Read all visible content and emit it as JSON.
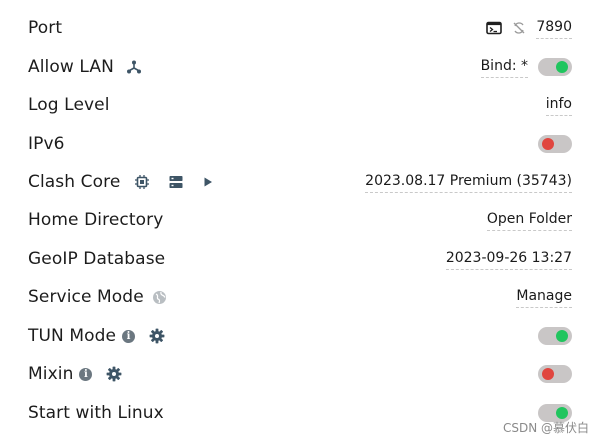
{
  "settings": {
    "port": {
      "label": "Port",
      "value": "7890",
      "icons": [
        "terminal-icon",
        "proxy-refresh-icon"
      ]
    },
    "allow_lan": {
      "label": "Allow LAN",
      "bind": "Bind: *",
      "toggle": "on",
      "icon": "network-icon"
    },
    "log_level": {
      "label": "Log Level",
      "value": "info"
    },
    "ipv6": {
      "label": "IPv6",
      "toggle": "off"
    },
    "clash_core": {
      "label": "Clash Core",
      "value": "2023.08.17 Premium (35743)",
      "icons": [
        "chip-icon",
        "server-icon",
        "play-icon"
      ]
    },
    "home_directory": {
      "label": "Home Directory",
      "value": "Open Folder"
    },
    "geoip": {
      "label": "GeoIP Database",
      "value": "2023-09-26 13:27"
    },
    "service_mode": {
      "label": "Service Mode",
      "value": "Manage",
      "icon": "globe-icon"
    },
    "tun_mode": {
      "label": "TUN Mode",
      "toggle": "on",
      "icons": [
        "info-icon",
        "gear-icon"
      ]
    },
    "mixin": {
      "label": "Mixin",
      "toggle": "off",
      "icons": [
        "info-icon",
        "gear-icon"
      ]
    },
    "start_with_linux": {
      "label": "Start with Linux",
      "toggle": "on"
    }
  },
  "colors": {
    "toggle_on": "#20c55e",
    "toggle_off": "#e0453e",
    "track": "#c9c6c6",
    "icon": "#3e5566"
  },
  "watermark": "CSDN @慕伏白"
}
